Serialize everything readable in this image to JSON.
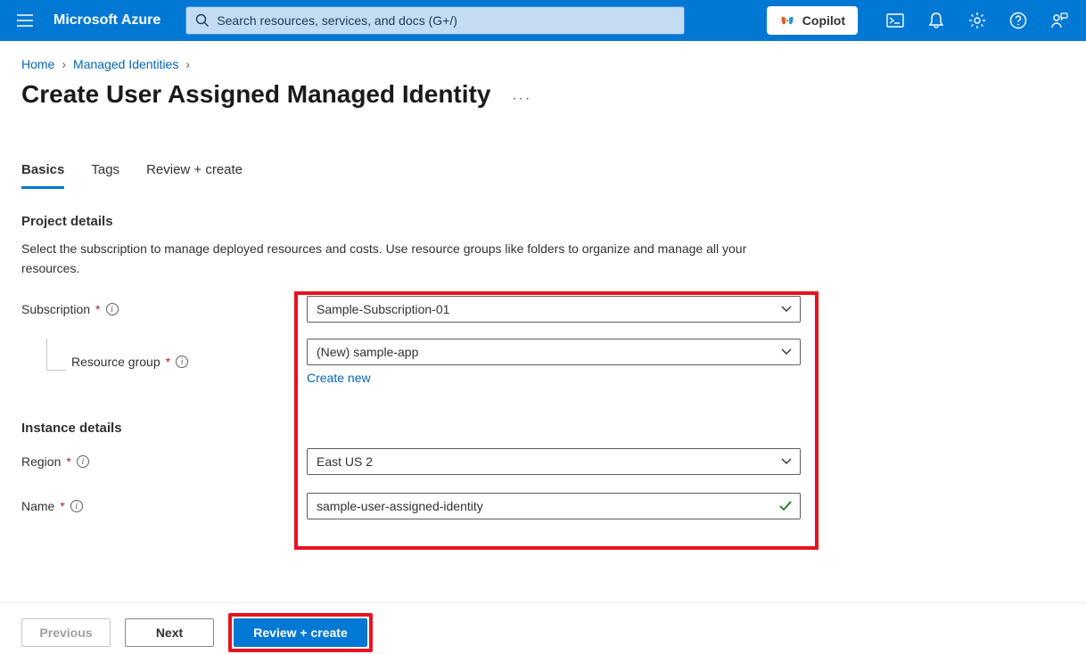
{
  "header": {
    "brand": "Microsoft Azure",
    "search_placeholder": "Search resources, services, and docs (G+/)",
    "copilot_label": "Copilot"
  },
  "breadcrumb": {
    "items": [
      "Home",
      "Managed Identities"
    ]
  },
  "page": {
    "title": "Create User Assigned Managed Identity"
  },
  "tabs": {
    "items": [
      "Basics",
      "Tags",
      "Review + create"
    ],
    "active_index": 0
  },
  "sections": {
    "project": {
      "title": "Project details",
      "description": "Select the subscription to manage deployed resources and costs. Use resource groups like folders to organize and manage all your resources."
    },
    "instance": {
      "title": "Instance details"
    }
  },
  "form": {
    "subscription": {
      "label": "Subscription",
      "value": "Sample-Subscription-01"
    },
    "resource_group": {
      "label": "Resource group",
      "value": "(New) sample-app",
      "create_new": "Create new"
    },
    "region": {
      "label": "Region",
      "value": "East US 2"
    },
    "name": {
      "label": "Name",
      "value": "sample-user-assigned-identity"
    }
  },
  "footer": {
    "previous": "Previous",
    "next": "Next",
    "review": "Review + create"
  }
}
